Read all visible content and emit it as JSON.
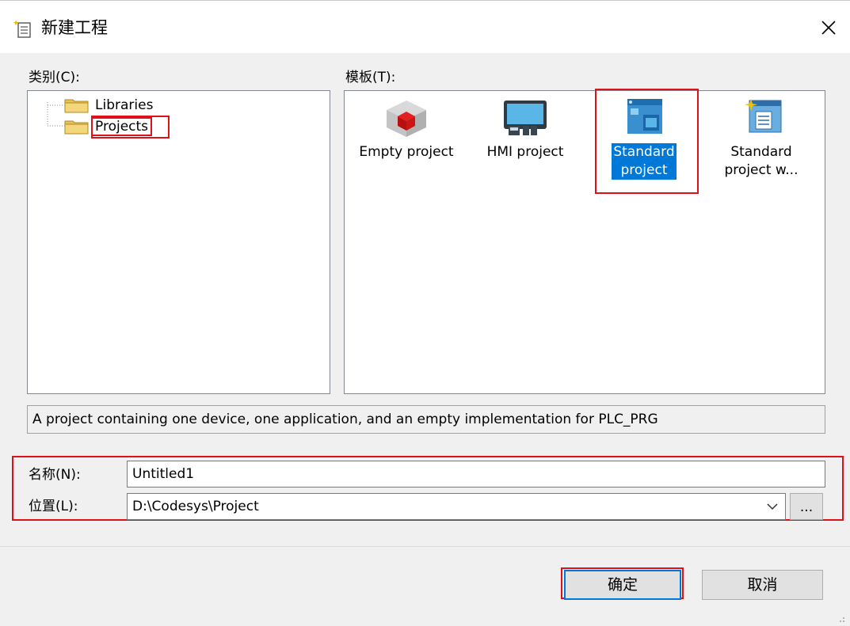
{
  "window": {
    "title": "新建工程",
    "close_glyph": "✕"
  },
  "categories": {
    "label": "类别(C):",
    "items": [
      {
        "label": "Libraries",
        "icon": "folder-icon",
        "selected": false
      },
      {
        "label": "Projects",
        "icon": "folder-icon",
        "selected": true
      }
    ]
  },
  "templates": {
    "label": "模板(T):",
    "items": [
      {
        "label": "Empty project",
        "icon": "empty-project-icon",
        "selected": false
      },
      {
        "label": "HMI project",
        "icon": "hmi-project-icon",
        "selected": false
      },
      {
        "label": "Standard\nproject",
        "icon": "standard-project-icon",
        "selected": true
      },
      {
        "label": "Standard\nproject w...",
        "icon": "standard-project-with-icon",
        "selected": false
      }
    ]
  },
  "description": "A project containing one device, one application, and an empty implementation for PLC_PRG",
  "fields": {
    "name": {
      "label": "名称(N):",
      "value": "Untitled1"
    },
    "location": {
      "label": "位置(L):",
      "value": "D:\\Codesys\\Project",
      "browse_label": "..."
    }
  },
  "buttons": {
    "ok": "确定",
    "cancel": "取消"
  },
  "colors": {
    "highlight_red": "#e0101a",
    "selection_blue": "#0078d7",
    "dialog_bg": "#f0f0f0"
  }
}
